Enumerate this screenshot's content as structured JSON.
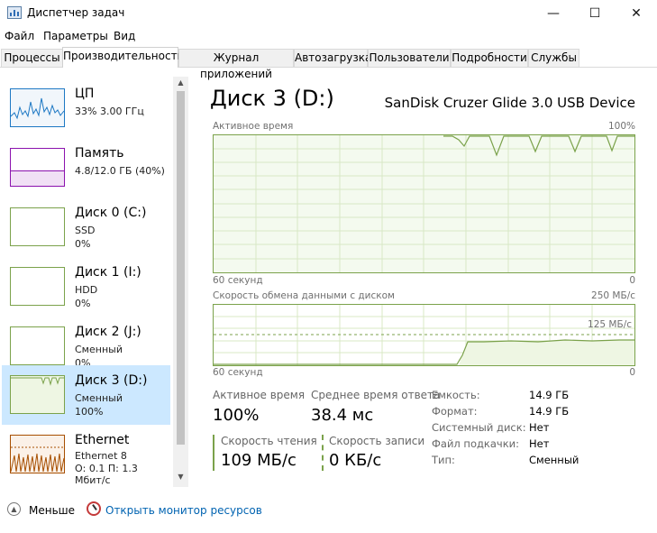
{
  "window": {
    "title": "Диспетчер задач",
    "minimize": "—",
    "maximize": "☐",
    "close": "✕"
  },
  "menu": [
    "Файл",
    "Параметры",
    "Вид"
  ],
  "tabs": [
    "Процессы",
    "Производительность",
    "Журнал приложений",
    "Автозагрузка",
    "Пользователи",
    "Подробности",
    "Службы"
  ],
  "sidebar": {
    "items": [
      {
        "title": "ЦП",
        "line1": "33%  3.00 ГГц",
        "line2": ""
      },
      {
        "title": "Память",
        "line1": "4.8/12.0 ГБ (40%)",
        "line2": ""
      },
      {
        "title": "Диск 0 (C:)",
        "line1": "SSD",
        "line2": "0%"
      },
      {
        "title": "Диск 1 (I:)",
        "line1": "HDD",
        "line2": "0%"
      },
      {
        "title": "Диск 2 (J:)",
        "line1": "Сменный",
        "line2": "0%"
      },
      {
        "title": "Диск 3 (D:)",
        "line1": "Сменный",
        "line2": "100%"
      },
      {
        "title": "Ethernet",
        "line1": "Ethernet 8",
        "line2": "О: 0.1  П: 1.3 Мбит/с"
      }
    ]
  },
  "main": {
    "title": "Диск 3 (D:)",
    "device": "SanDisk Cruzer Glide 3.0 USB Device",
    "chart1": {
      "label": "Активное время",
      "max": "100%",
      "time": "60 секунд",
      "zero": "0"
    },
    "chart2": {
      "label": "Скорость обмена данными с диском",
      "max": "250 МБ/с",
      "mid": "125 МБ/с",
      "time": "60 секунд",
      "zero": "0"
    },
    "stats": {
      "active_label": "Активное время",
      "active_value": "100%",
      "avg_label": "Среднее время ответа",
      "avg_value": "38.4 мс",
      "read_label": "Скорость чтения",
      "read_value": "109 МБ/с",
      "write_label": "Скорость записи",
      "write_value": "0 КБ/с"
    },
    "info": [
      {
        "label": "Емкость:",
        "value": "14.9 ГБ"
      },
      {
        "label": "Формат:",
        "value": "14.9 ГБ"
      },
      {
        "label": "Системный диск:",
        "value": "Нет"
      },
      {
        "label": "Файл подкачки:",
        "value": "Нет"
      },
      {
        "label": "Тип:",
        "value": "Сменный"
      }
    ]
  },
  "footer": {
    "less": "Меньше",
    "open_monitor": "Открыть монитор ресурсов"
  },
  "colors": {
    "accent_disk": "#7ba24b",
    "cpu": "#1d78c4",
    "memory": "#8b12ae",
    "ethernet": "#a74f01",
    "selected": "#cce8ff",
    "link": "#0063b1"
  }
}
